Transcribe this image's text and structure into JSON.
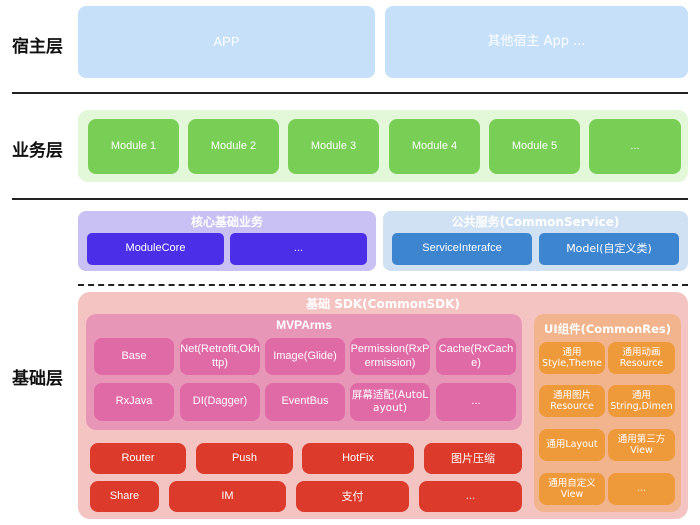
{
  "layers": {
    "host": {
      "label": "宿主层",
      "apps": [
        "APP",
        "其他宿主 App ..."
      ]
    },
    "business": {
      "label": "业务层",
      "modules": [
        "Module 1",
        "Module 2",
        "Module 3",
        "Module 4",
        "Module 5",
        "..."
      ]
    },
    "base": {
      "label": "基础层",
      "core": {
        "title": "核心基础业务",
        "items": [
          "ModuleCore",
          "..."
        ]
      },
      "common_service": {
        "title": "公共服务(CommonService)",
        "items": [
          "ServiceInterafce",
          "Model(自定义类)"
        ]
      },
      "common_sdk": {
        "title": "基础 SDK(CommonSDK)",
        "mvparms": {
          "title": "MVPArms",
          "items": [
            "Base",
            "Net(Retrofit,Okhttp)",
            "Image(Glide)",
            "Permission(RxPermission)",
            "Cache(RxCache)",
            "RxJava",
            "DI(Dagger)",
            "EventBus",
            "屏幕适配(AutoLayout)",
            "..."
          ]
        },
        "tools_row1": [
          "Router",
          "Push",
          "HotFix",
          "图片压缩"
        ],
        "tools_row2": [
          "Share",
          "IM",
          "支付",
          "..."
        ],
        "common_res": {
          "title": "UI组件(CommonRes)",
          "items": [
            "通用 Style,Theme",
            "通用动画 Resource",
            "通用图片 Resource",
            "通用 String,Dimen",
            "通用Layout",
            "通用第三方 View",
            "通用自定义 View",
            "..."
          ]
        }
      }
    }
  },
  "colors": {
    "host_box": "#c6e0fa",
    "business_bg": "#e2f8d8",
    "business_module": "#79cf55",
    "core_bg": "#c9c0f3",
    "core_item": "#4a2ee8",
    "service_bg": "#cfe1f2",
    "service_item": "#3d85cf",
    "sdk_bg": "#f4c4c2",
    "mvparms_bg": "#e896b8",
    "mvparms_item": "#e06aa6",
    "tool_item": "#dc3b2b",
    "res_bg": "#f1b48c",
    "res_item": "#ee9a3b"
  }
}
